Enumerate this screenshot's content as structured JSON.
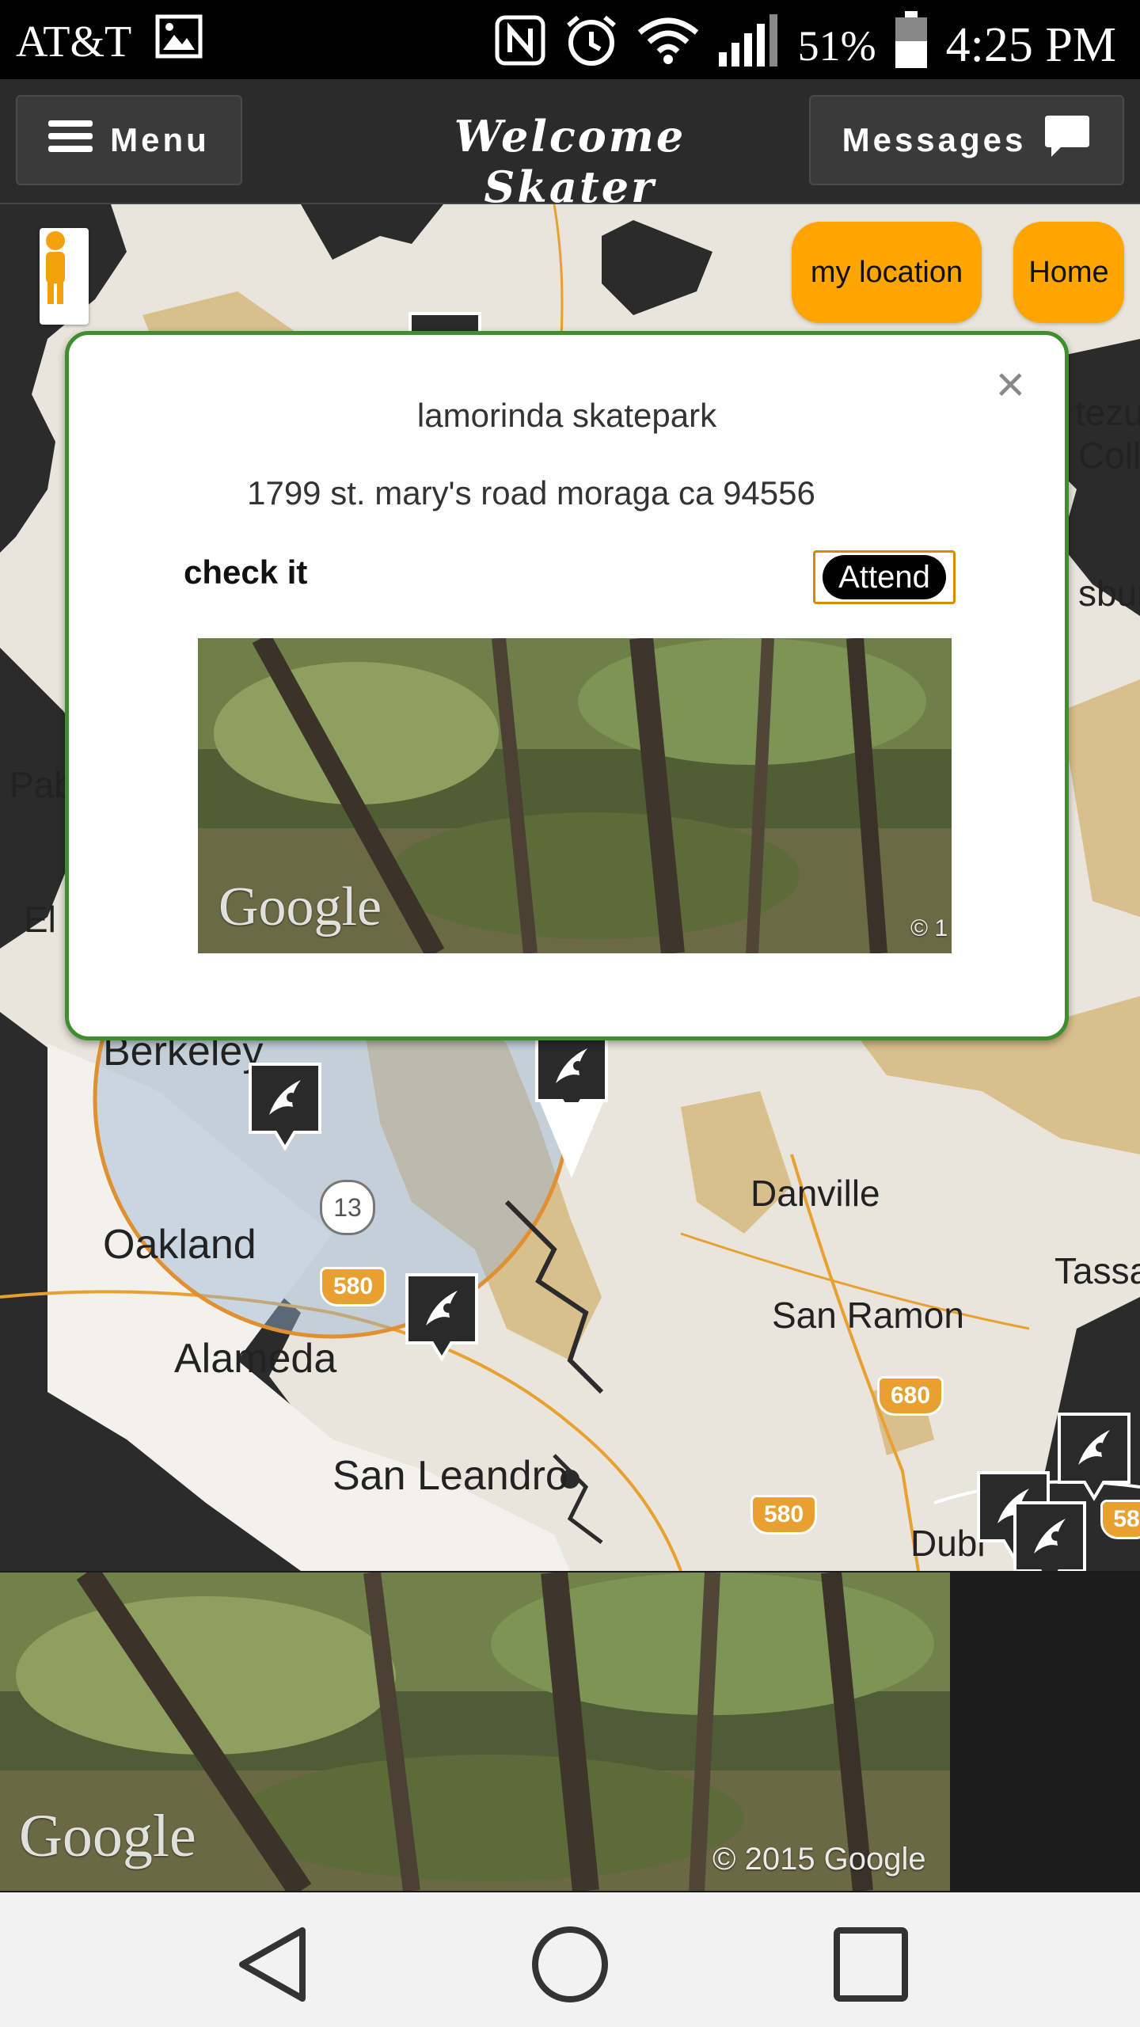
{
  "status_bar": {
    "carrier": "AT&T",
    "battery": "51%",
    "time": "4:25 PM"
  },
  "header": {
    "menu_label": "Menu",
    "title": "Welcome Skater",
    "messages_label": "Messages"
  },
  "map": {
    "my_location_label": "my location",
    "home_label": "Home",
    "labels": [
      "Berkeley",
      "Oakland",
      "Alameda",
      "San Leandro",
      "Danville",
      "San Ramon",
      "Tassa",
      "Dubl",
      "Pab",
      "El",
      "tezu",
      "Coll",
      "sbur"
    ],
    "highways": [
      "13",
      "580",
      "580",
      "680",
      "580",
      "58"
    ]
  },
  "info_window": {
    "name": "lamorinda skatepark",
    "address": "1799 st. mary's road moraga ca 94556",
    "check_label": "check it",
    "attend_label": "Attend",
    "watermark": "Google",
    "photo_copyright": "© 1"
  },
  "street_view": {
    "watermark": "Google",
    "copyright": "© 2015 Google"
  },
  "nav": {
    "back_icon": "back-triangle-icon",
    "home_icon": "home-circle-icon",
    "recents_icon": "recents-square-icon"
  },
  "colors": {
    "accent_orange": "#ffa500",
    "infowindow_border": "#3e8e2e",
    "header_bg": "#2b2b2b"
  }
}
